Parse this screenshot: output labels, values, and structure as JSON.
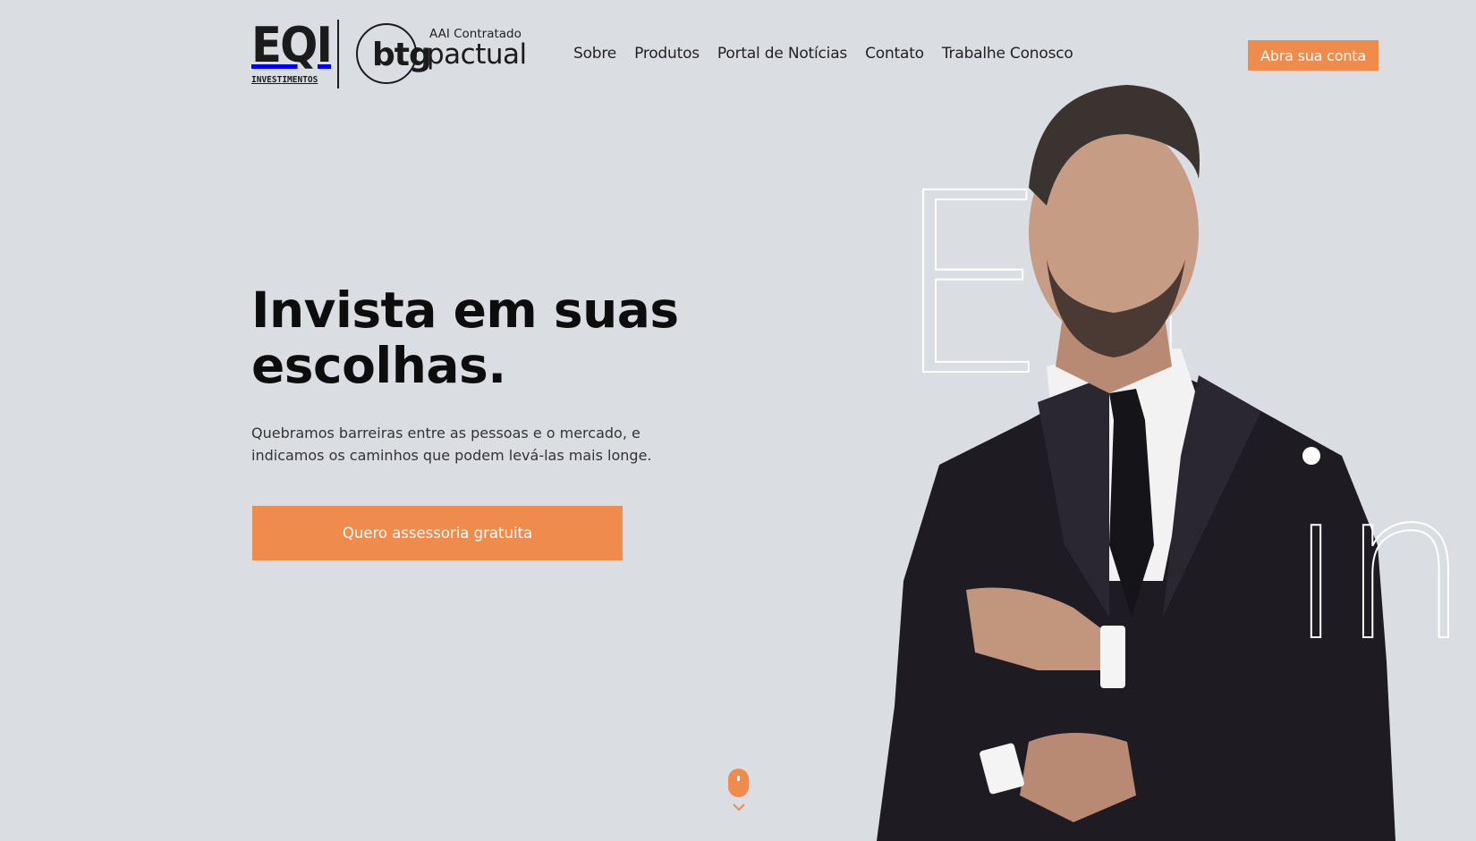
{
  "header": {
    "logo_eqi": {
      "main": "EQI",
      "sub": "INVESTIMENTOS"
    },
    "logo_btg": {
      "tag": "AAI Contratado",
      "btg": "btg",
      "pactual": "pactual"
    },
    "nav": [
      {
        "label": "Sobre"
      },
      {
        "label": "Produtos"
      },
      {
        "label": "Portal de Notícias"
      },
      {
        "label": "Contato"
      },
      {
        "label": "Trabalhe Conosco"
      }
    ],
    "cta_label": "Abra sua conta"
  },
  "hero": {
    "title": "Invista em suas escolhas.",
    "subtitle": "Quebramos barreiras entre as pessoas e o mercado, e indicamos os caminhos que podem levá-las mais longe.",
    "cta_label": "Quero assessoria gratuita"
  },
  "decoration": {
    "word_1": "Eu",
    "word_2": "ın"
  },
  "colors": {
    "background": "#dadee2",
    "accent": "#ee8b4d",
    "text": "#111111"
  },
  "icons": {
    "scroll_mouse": "mouse-scroll-icon",
    "scroll_arrow": "chevron-down-icon"
  }
}
